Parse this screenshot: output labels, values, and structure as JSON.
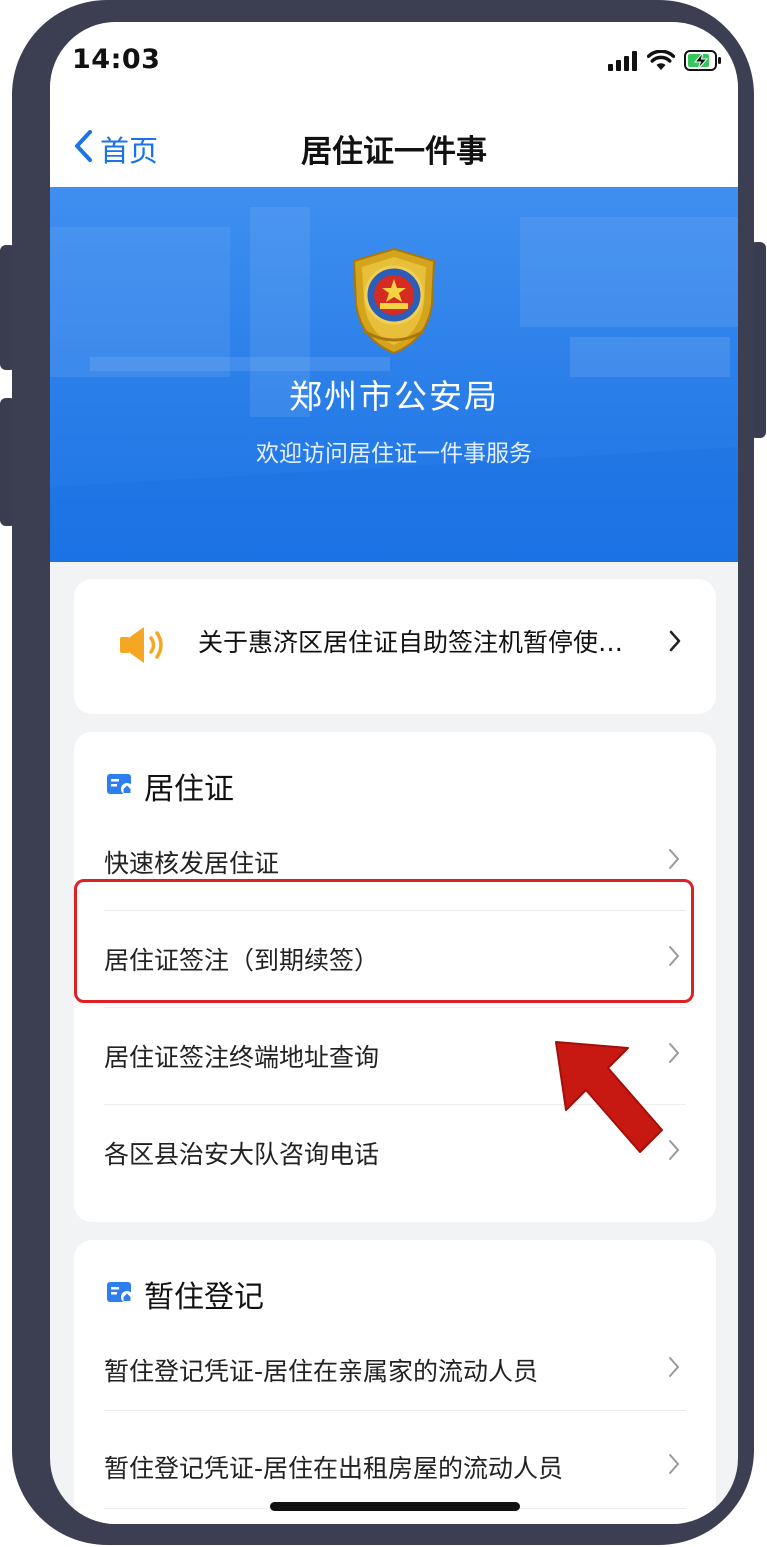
{
  "status_bar": {
    "time": "14:03"
  },
  "nav": {
    "back_label": "首页",
    "title": "居住证一件事"
  },
  "banner": {
    "title": "郑州市公安局",
    "subtitle": "欢迎访问居住证一件事服务"
  },
  "notice": {
    "text": "关于惠济区居住证自助签注机暂停使…",
    "chevron": "›"
  },
  "sections": [
    {
      "title": "居住证",
      "items": [
        {
          "label": "快速核发居住证",
          "chevron": "›"
        },
        {
          "label": "居住证签注（到期续签）",
          "chevron": "›"
        },
        {
          "label": "居住证签注终端地址查询",
          "chevron": "›"
        },
        {
          "label": "各区县治安大队咨询电话",
          "chevron": "›"
        }
      ]
    },
    {
      "title": "暂住登记",
      "items": [
        {
          "label": "暂住登记凭证-居住在亲属家的流动人员",
          "chevron": "›"
        },
        {
          "label": "暂住登记凭证-居住在出租房屋的流动人员",
          "chevron": "›"
        }
      ]
    }
  ],
  "colors": {
    "accent": "#1a73e8",
    "banner": "#2a7ee8",
    "highlight": "#e02027",
    "arrow": "#c81812",
    "speaker": "#f5a623"
  },
  "icons": [
    "back-chevron-icon",
    "signal-icon",
    "wifi-icon",
    "battery-charging-icon",
    "police-emblem-icon",
    "speaker-icon",
    "chevron-right-icon",
    "id-card-icon",
    "annotation-arrow-icon"
  ]
}
